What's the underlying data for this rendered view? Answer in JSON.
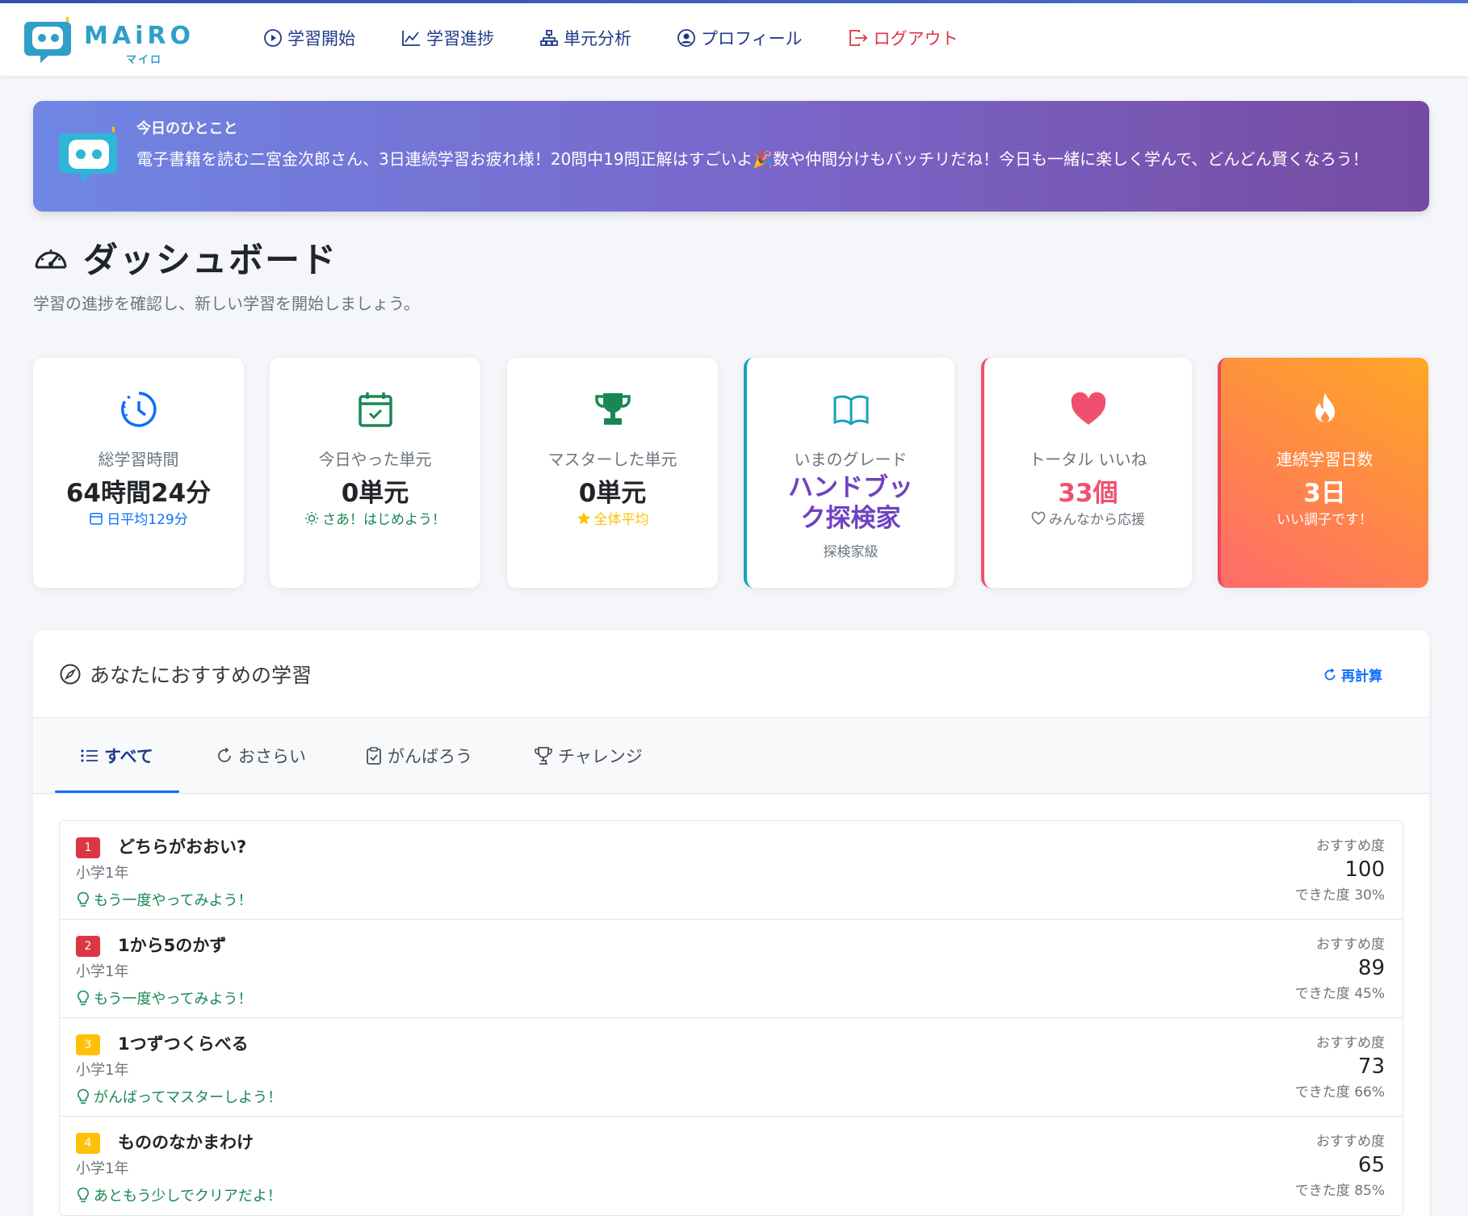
{
  "app": {
    "logo_text": "MAiRO",
    "logo_sub": "マイロ"
  },
  "nav": [
    {
      "label": "学習開始",
      "icon": "play-circle-icon"
    },
    {
      "label": "学習進捗",
      "icon": "line-chart-icon"
    },
    {
      "label": "単元分析",
      "icon": "diagram-icon"
    },
    {
      "label": "プロフィール",
      "icon": "user-circle-icon"
    },
    {
      "label": "ログアウト",
      "icon": "logout-icon"
    }
  ],
  "hero": {
    "label": "今日のひとこと",
    "message": "電子書籍を読む二宮金次郎さん、3日連続学習お疲れ様！20問中19問正解はすごいよ🎉数や仲間分けもバッチリだね！今日も一緒に楽しく学んで、どんどん賢くなろう！"
  },
  "page": {
    "title": "ダッシュボード",
    "subtitle": "学習の進捗を確認し、新しい学習を開始しましょう。"
  },
  "cards": [
    {
      "label": "総学習時間",
      "value": "64時間24分",
      "note": "日平均129分",
      "note_color": "#0d6efd"
    },
    {
      "label": "今日やった単元",
      "value": "0単元",
      "note": "さあ！はじめよう！",
      "note_color": "#198754"
    },
    {
      "label": "マスターした単元",
      "value": "0単元",
      "note": "全体平均",
      "note_color": "#ffc107"
    },
    {
      "label": "いまのグレード",
      "value": "ハンドブック探検家",
      "note": "探検家級"
    },
    {
      "label": "トータル いいね",
      "value": "33個",
      "note": "みんなから応援"
    },
    {
      "label": "連続学習日数",
      "value": "3日",
      "note": "いい調子です！"
    }
  ],
  "recommend": {
    "title": "あなたにおすすめの学習",
    "recalc_label": "再計算",
    "tabs": [
      "すべて",
      "おさらい",
      "がんばろう",
      "チャレンジ"
    ],
    "rec_label": "おすすめ度",
    "items": [
      {
        "rank": "1",
        "title": "どちらがおおい?",
        "grade": "小学1年",
        "hint": "もう一度やってみよう！",
        "score": "100",
        "done": "できた度 30%"
      },
      {
        "rank": "2",
        "title": "1から5のかず",
        "grade": "小学1年",
        "hint": "もう一度やってみよう！",
        "score": "89",
        "done": "できた度 45%"
      },
      {
        "rank": "3",
        "title": "1つずつくらべる",
        "grade": "小学1年",
        "hint": "がんばってマスターしよう！",
        "score": "73",
        "done": "できた度 66%"
      },
      {
        "rank": "4",
        "title": "もののなかまわけ",
        "grade": "小学1年",
        "hint": "あともう少しでクリアだよ！",
        "score": "65",
        "done": "できた度 85%"
      }
    ]
  },
  "colors": {
    "accent": "#1f3a8a",
    "danger": "#dc3545",
    "success": "#198754",
    "warning": "#ffc107",
    "purple": "#6f42c1"
  }
}
